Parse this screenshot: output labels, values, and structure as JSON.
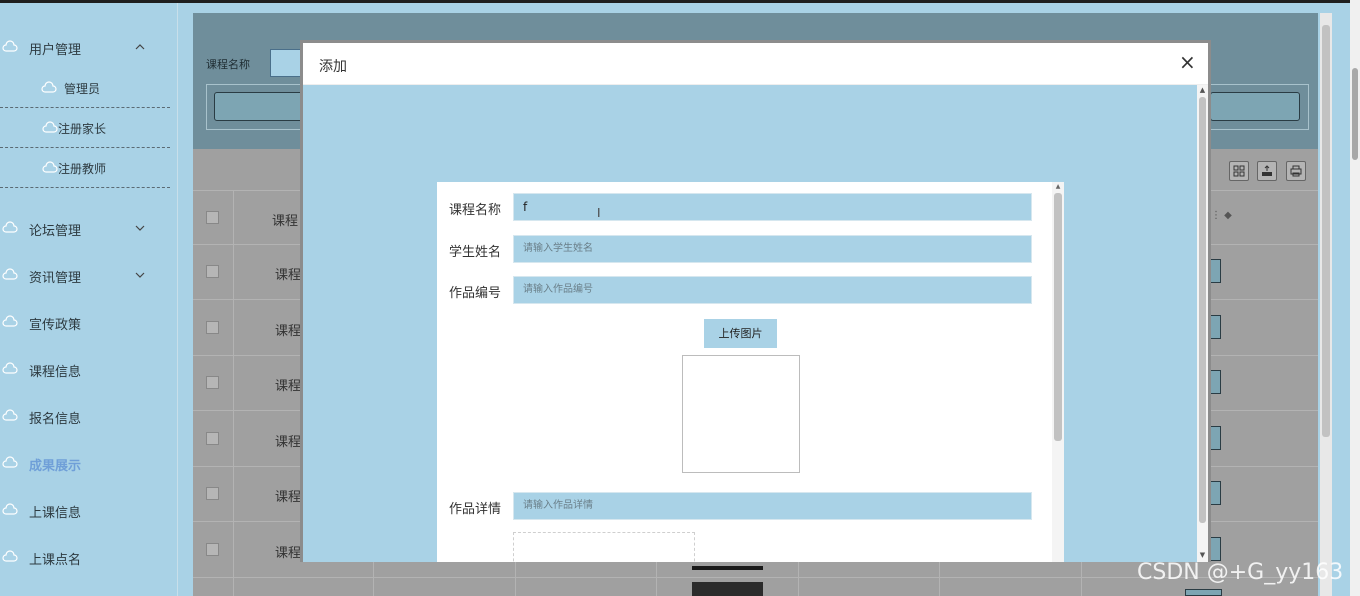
{
  "sidebar": {
    "user_mgmt": "用户管理",
    "sub_items": [
      "管理员",
      "注册家长",
      "注册教师"
    ],
    "items": [
      {
        "label": "论坛管理",
        "has_chevron": true
      },
      {
        "label": "资讯管理",
        "has_chevron": true
      },
      {
        "label": "宣传政策",
        "has_chevron": false
      },
      {
        "label": "课程信息",
        "has_chevron": false
      },
      {
        "label": "报名信息",
        "has_chevron": false
      },
      {
        "label": "成果展示",
        "has_chevron": false,
        "active": true
      },
      {
        "label": "上课信息",
        "has_chevron": false
      },
      {
        "label": "上课点名",
        "has_chevron": false
      }
    ]
  },
  "search": {
    "label": "课程名称"
  },
  "table": {
    "header_label": "课程",
    "row_label": "课程",
    "row_count": 6
  },
  "modal": {
    "title": "添加",
    "close_symbol": "×",
    "form": {
      "course_name": {
        "label": "课程名称",
        "value": "f"
      },
      "student_name": {
        "label": "学生姓名",
        "placeholder": "请输入学生姓名"
      },
      "work_no": {
        "label": "作品编号",
        "placeholder": "请输入作品编号"
      },
      "upload_button": "上传图片",
      "work_detail": {
        "label": "作品详情",
        "placeholder": "请输入作品详情"
      }
    }
  },
  "watermark": "CSDN @+G_yy163",
  "colors": {
    "accent": "#a9d2e6",
    "active_nav": "#6f9fd8",
    "overlay": "#a0a0a0"
  },
  "icons": [
    "cloud-icon",
    "chevron-up-icon",
    "chevron-down-icon",
    "grid-icon",
    "export-icon",
    "print-icon",
    "close-icon",
    "sort-icon"
  ]
}
